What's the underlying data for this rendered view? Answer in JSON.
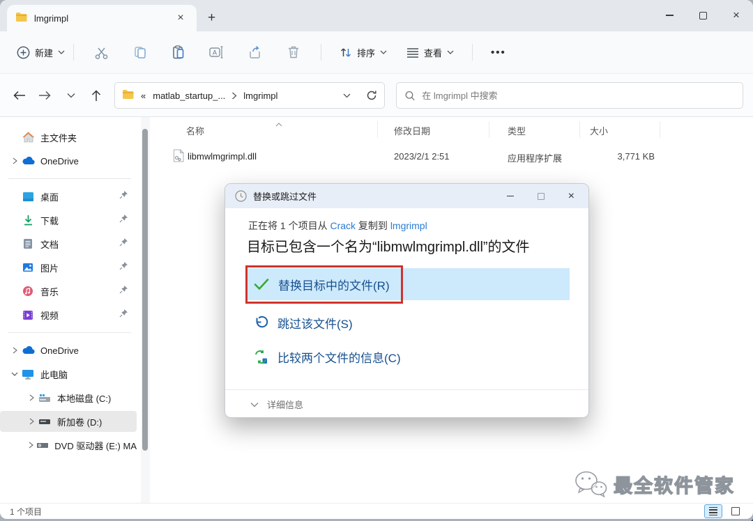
{
  "window": {
    "tab_title": "lmgrimpl",
    "new_tab_label": "+",
    "close_label": "×"
  },
  "toolbar": {
    "new_label": "新建",
    "sort_label": "排序",
    "view_label": "查看",
    "more_label": "•••"
  },
  "navbar": {
    "overflow_symbol": "«",
    "crumb_parent": "matlab_startup_...",
    "crumb_current": "lmgrimpl",
    "search_placeholder": "在 lmgrimpl 中搜索"
  },
  "sidebar": {
    "items": [
      {
        "label": "主文件夹"
      },
      {
        "label": "OneDrive"
      },
      {
        "label": "桌面"
      },
      {
        "label": "下载"
      },
      {
        "label": "文档"
      },
      {
        "label": "图片"
      },
      {
        "label": "音乐"
      },
      {
        "label": "视频"
      },
      {
        "label": "OneDrive"
      },
      {
        "label": "此电脑"
      },
      {
        "label": "本地磁盘 (C:)"
      },
      {
        "label": "新加卷 (D:)"
      },
      {
        "label": "DVD 驱动器 (E:) MA"
      }
    ]
  },
  "file_list": {
    "columns": {
      "name": "名称",
      "modified": "修改日期",
      "type": "类型",
      "size": "大小"
    },
    "rows": [
      {
        "name": "libmwlmgrimpl.dll",
        "modified": "2023/2/1 2:51",
        "type": "应用程序扩展",
        "size": "3,771 KB"
      }
    ]
  },
  "dialog": {
    "title": "替换或跳过文件",
    "copy_prefix": "正在将 1 个项目从 ",
    "copy_source": "Crack",
    "copy_middle": " 复制到 ",
    "copy_dest": "lmgrimpl",
    "headline": "目标已包含一个名为“libmwlmgrimpl.dll”的文件",
    "replace_label": "替换目标中的文件(R)",
    "skip_label": "跳过该文件(S)",
    "compare_label": "比较两个文件的信息(C)",
    "details_label": "详细信息"
  },
  "statusbar": {
    "item_count": "1 个项目"
  },
  "watermark": {
    "text": "最全软件管家"
  },
  "colors": {
    "option_blue": "#17508f",
    "link_blue": "#2b7cd3",
    "highlight_blue": "#cde9fc",
    "annotation_red": "#ce332e",
    "check_green": "#37a935"
  }
}
